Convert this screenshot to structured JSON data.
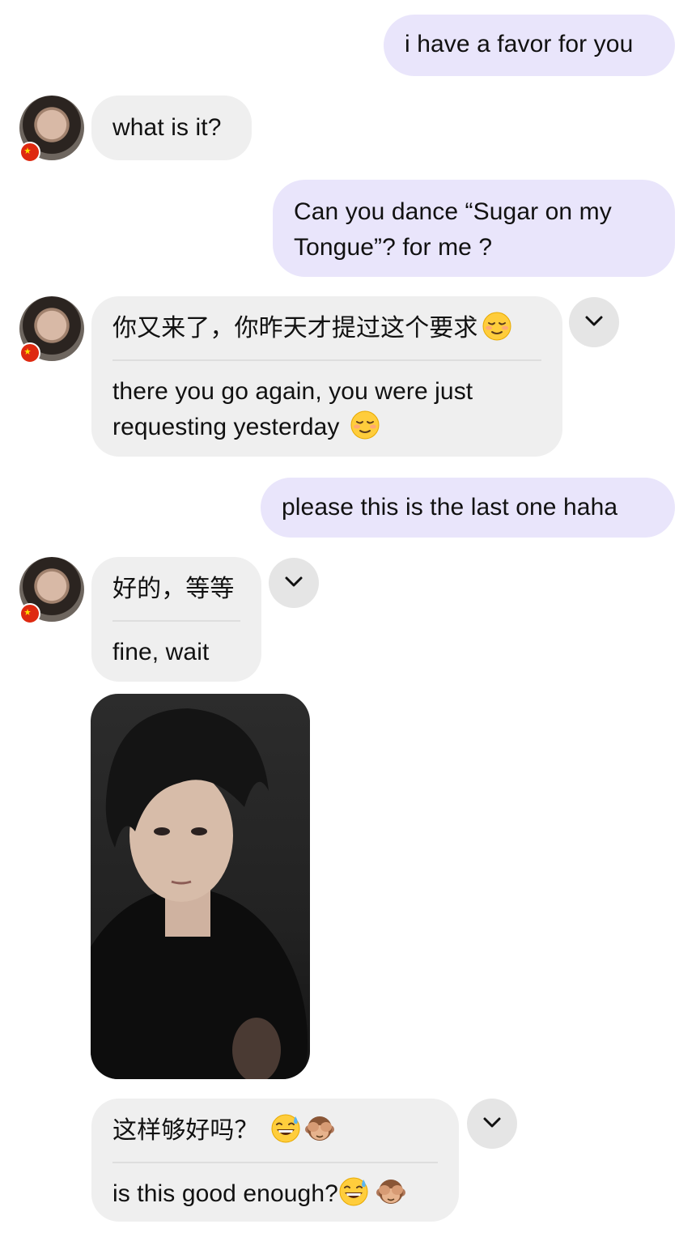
{
  "messages": [
    {
      "sender": "me",
      "text": "i have a favor for you"
    },
    {
      "sender": "them",
      "text": "what is it?"
    },
    {
      "sender": "me",
      "text": "Can you dance “Sugar on my Tongue”? for me ?"
    },
    {
      "sender": "them",
      "original": "你又来了，你昨天才提过这个要求",
      "translation": "there you go again, you were just requesting yesterday",
      "emoji": [
        "relieved-face"
      ]
    },
    {
      "sender": "me",
      "text": "please this is the last one haha"
    },
    {
      "sender": "them",
      "original": "好的，等等",
      "translation": "fine, wait"
    },
    {
      "sender": "them",
      "type": "video"
    },
    {
      "sender": "them",
      "original": "这样够好吗？",
      "translation": "is this good enough?",
      "emoji": [
        "grinning-sweat-face",
        "see-no-evil-monkey"
      ]
    }
  ],
  "colors": {
    "outgoing_bubble": "#e9e5fb",
    "incoming_bubble": "#efefef",
    "flag_badge": "#de2910"
  },
  "icons": [
    "avatar",
    "china-flag-badge",
    "chevron-down-icon"
  ]
}
